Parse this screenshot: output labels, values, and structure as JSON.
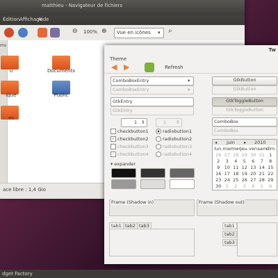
{
  "file_manager": {
    "title": "matthieu - Navigateur de fichiers",
    "menu": [
      "Édition",
      "Affichage",
      "Aide"
    ],
    "zoom": "100%",
    "view_mode": "Vue en icônes",
    "folders": [
      "u",
      "Documents",
      "ique",
      "Public",
      "es"
    ],
    "status": "ace libre : 1,4 Gio",
    "sidebar_tab": "ms"
  },
  "theme_window": {
    "title": "Theme",
    "truncated_title": "Tw",
    "refresh_label": "Refresh",
    "combo_entries": [
      "ComboBoxEntry",
      "ComboBoxEntry"
    ],
    "gtk_entries": [
      "GtkEntry",
      "GtkEntry"
    ],
    "spins": [
      "1",
      "1"
    ],
    "checkbuttons": [
      "checkbutton1",
      "checkbutton2",
      "checkbutton3",
      "checkbutton4"
    ],
    "radiobuttons": [
      "radiobutton1",
      "radiobutton2",
      "radiobutton3",
      "radiobutton4"
    ],
    "expander": "expander",
    "gtk_buttons": [
      "GtkButton",
      "GtkButton"
    ],
    "toggle_buttons": [
      "GtkToggleButton",
      "GtkToggleButton"
    ],
    "combo_boxes": [
      "ComboBox",
      "ComboBox"
    ],
    "calendar": {
      "month": "juin",
      "year": "2010",
      "weekdays": [
        "lun.",
        "mar.",
        "mer.",
        "jeu.",
        "ven.",
        "sam.",
        "dim."
      ],
      "rows": [
        [
          "26",
          "27",
          "28",
          "29",
          "30",
          "31",
          "1"
        ],
        [
          "2",
          "3",
          "4",
          "5",
          "6",
          "7",
          "8"
        ],
        [
          "9",
          "10",
          "11",
          "12",
          "13",
          "14",
          "15"
        ],
        [
          "16",
          "17",
          "18",
          "19",
          "20",
          "21",
          "22"
        ],
        [
          "23",
          "24",
          "25",
          "26",
          "27",
          "28",
          "29"
        ],
        [
          "30",
          "1",
          "2",
          "3",
          "4",
          "5",
          "6"
        ]
      ]
    },
    "frames": [
      "Frame (Shadow in)",
      "Frame (Shadow out)"
    ],
    "tabs_top": [
      "tab1",
      "tab2",
      "tab3"
    ],
    "tabs_side": [
      "tab1",
      "tab2",
      "tab3"
    ]
  },
  "taskbar": {
    "label": "dget Factory"
  },
  "colors": {
    "accent": "#f07746",
    "title_bar": "#3c3b37",
    "bg": "#f2f1ef"
  }
}
